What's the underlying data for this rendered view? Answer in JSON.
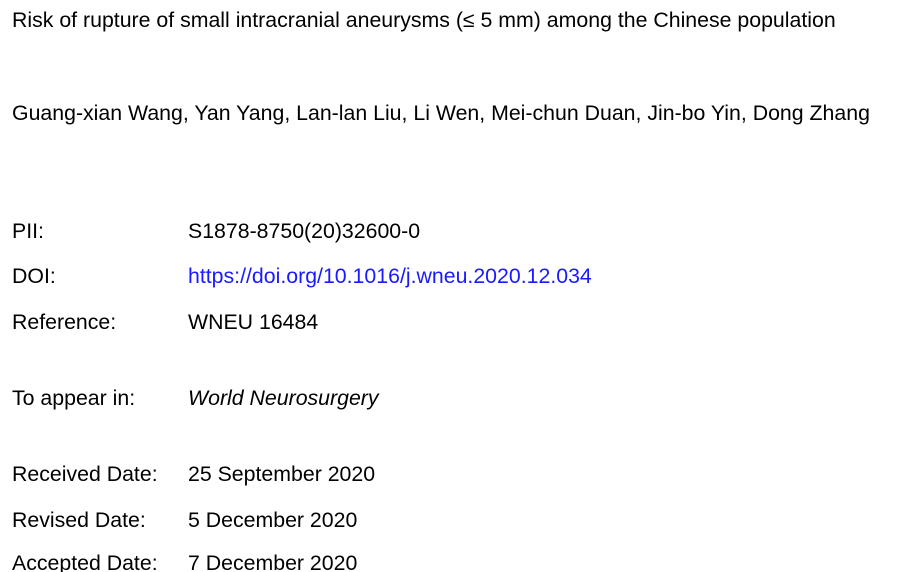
{
  "article": {
    "title": "Risk of rupture of small intracranial aneurysms (≤ 5 mm) among the Chinese population",
    "authors": "Guang-xian Wang, Yan Yang, Lan-lan Liu, Li Wen, Mei-chun Duan, Jin-bo Yin, Dong Zhang"
  },
  "meta": {
    "pii_label": "PII:",
    "pii_value": "S1878-8750(20)32600-0",
    "doi_label": "DOI:",
    "doi_value": "https://doi.org/10.1016/j.wneu.2020.12.034",
    "reference_label": "Reference:",
    "reference_value": "WNEU 16484",
    "appear_label": "To appear in:",
    "appear_value": "World Neurosurgery",
    "received_label": "Received Date:",
    "received_value": "25 September 2020",
    "revised_label": "Revised Date:",
    "revised_value": "5 December 2020",
    "accepted_label": "Accepted Date:",
    "accepted_value": "7 December 2020"
  },
  "colors": {
    "text": "#000000",
    "link": "#1a1aff",
    "background": "#ffffff"
  }
}
